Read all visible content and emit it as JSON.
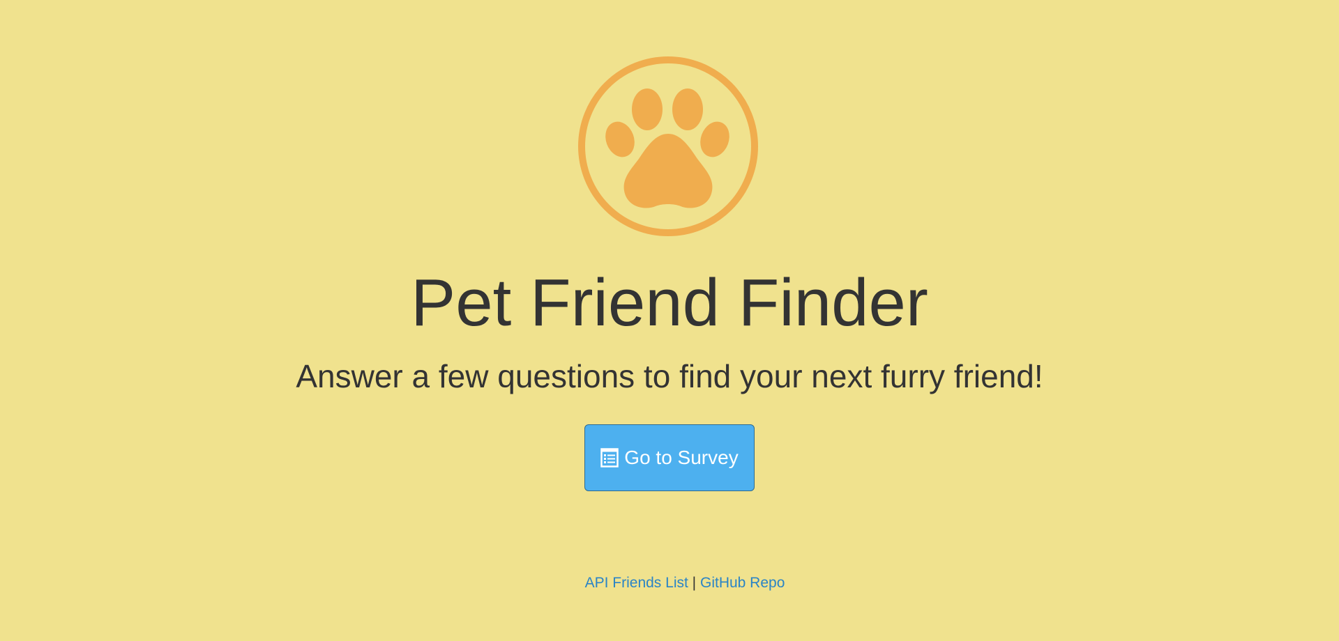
{
  "header": {
    "logo_icon": "paw-print-icon",
    "accent_color": "#f0ad4e",
    "background_color": "#f0e28e"
  },
  "main": {
    "title": "Pet Friend Finder",
    "subtitle": "Answer a few questions to find your next furry friend!",
    "survey_button": {
      "label": "Go to Survey",
      "icon": "list-alt-icon",
      "color": "#4db0ef"
    }
  },
  "footer": {
    "api_link": "API Friends List",
    "separator": "|",
    "github_link": "GitHub Repo",
    "link_color": "#2a84c6"
  }
}
